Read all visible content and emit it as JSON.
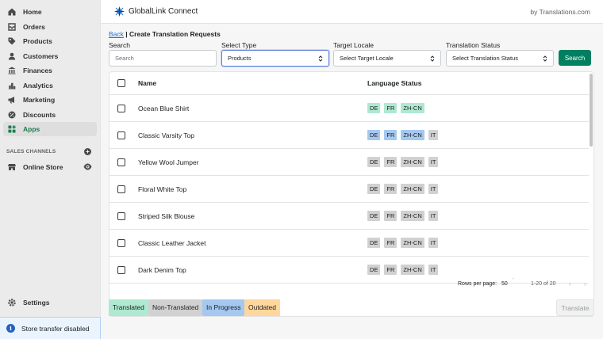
{
  "sidebar": {
    "items": [
      {
        "label": "Home",
        "icon": "home-icon"
      },
      {
        "label": "Orders",
        "icon": "orders-icon"
      },
      {
        "label": "Products",
        "icon": "tag-icon"
      },
      {
        "label": "Customers",
        "icon": "person-icon"
      },
      {
        "label": "Finances",
        "icon": "bank-icon"
      },
      {
        "label": "Analytics",
        "icon": "bar-chart-icon"
      },
      {
        "label": "Marketing",
        "icon": "megaphone-icon"
      },
      {
        "label": "Discounts",
        "icon": "discount-icon"
      },
      {
        "label": "Apps",
        "icon": "apps-icon",
        "active": true
      }
    ],
    "sales_channels_label": "SALES CHANNELS",
    "online_store_label": "Online Store",
    "settings_label": "Settings",
    "store_transfer_text": "Store transfer disabled"
  },
  "header": {
    "app_title": "GlobalLink Connect",
    "byline": "by Translations.com"
  },
  "breadcrumb": {
    "back": "Back",
    "separator_title": "| Create Translation Requests"
  },
  "filters": {
    "search_label": "Search",
    "search_placeholder": "Search",
    "type_label": "Select Type",
    "type_value": "Products",
    "locale_label": "Target Locale",
    "locale_value": "Select Target Locale",
    "status_label": "Translation Status",
    "status_value": "Select Translation Status",
    "search_button": "Search"
  },
  "table": {
    "col_name": "Name",
    "col_status": "Language Status",
    "rows": [
      {
        "name": "Ocean Blue Shirt",
        "tags": [
          {
            "code": "DE",
            "status": "translated"
          },
          {
            "code": "FR",
            "status": "translated"
          },
          {
            "code": "ZH-CN",
            "status": "translated"
          }
        ]
      },
      {
        "name": "Classic Varsity Top",
        "tags": [
          {
            "code": "DE",
            "status": "progress"
          },
          {
            "code": "FR",
            "status": "progress"
          },
          {
            "code": "ZH-CN",
            "status": "progress"
          },
          {
            "code": "IT",
            "status": "non"
          }
        ]
      },
      {
        "name": "Yellow Wool Jumper",
        "tags": [
          {
            "code": "DE",
            "status": "non"
          },
          {
            "code": "FR",
            "status": "non"
          },
          {
            "code": "ZH-CN",
            "status": "non"
          },
          {
            "code": "IT",
            "status": "non"
          }
        ]
      },
      {
        "name": "Floral White Top",
        "tags": [
          {
            "code": "DE",
            "status": "non"
          },
          {
            "code": "FR",
            "status": "non"
          },
          {
            "code": "ZH-CN",
            "status": "non"
          },
          {
            "code": "IT",
            "status": "non"
          }
        ]
      },
      {
        "name": "Striped Silk Blouse",
        "tags": [
          {
            "code": "DE",
            "status": "non"
          },
          {
            "code": "FR",
            "status": "non"
          },
          {
            "code": "ZH-CN",
            "status": "non"
          },
          {
            "code": "IT",
            "status": "non"
          }
        ]
      },
      {
        "name": "Classic Leather Jacket",
        "tags": [
          {
            "code": "DE",
            "status": "non"
          },
          {
            "code": "FR",
            "status": "non"
          },
          {
            "code": "ZH-CN",
            "status": "non"
          },
          {
            "code": "IT",
            "status": "non"
          }
        ]
      },
      {
        "name": "Dark Denim Top",
        "tags": [
          {
            "code": "DE",
            "status": "non"
          },
          {
            "code": "FR",
            "status": "non"
          },
          {
            "code": "ZH-CN",
            "status": "non"
          },
          {
            "code": "IT",
            "status": "non"
          }
        ]
      }
    ]
  },
  "pagination": {
    "rows_per_page_label": "Rows per page:",
    "rows_per_page_value": "50",
    "range": "1-20 of 20"
  },
  "legend": {
    "translated": "Translated",
    "non_translated": "Non-Translated",
    "in_progress": "In Progress",
    "outdated": "Outdated"
  },
  "actions": {
    "translate_button": "Translate"
  },
  "colors": {
    "accent": "#008060",
    "translated": "#aee9d1",
    "non_translated": "#d1d1d1",
    "in_progress": "#a4c8f0",
    "outdated": "#ffd79d"
  }
}
